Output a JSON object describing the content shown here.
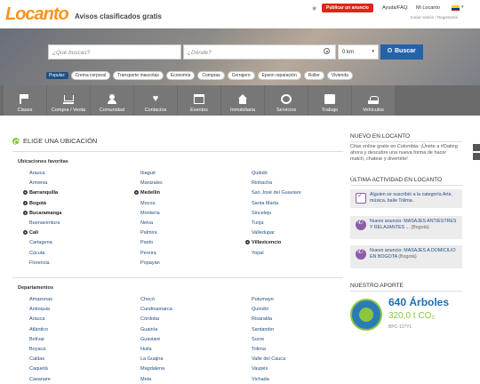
{
  "header": {
    "logo": "Locanto",
    "tagline": "Avisos clasificados gratis",
    "publish_label": "Publicar un anuncio",
    "help_label": "Ayuda/FAQ:",
    "my_label": "Mi Locanto",
    "login_links": "Iniciar sesión / Registrarse"
  },
  "search": {
    "what_placeholder": "¿Qué buscas?",
    "where_placeholder": "¿Dónde?",
    "radius_value": "0 km",
    "button_label": "Buscar",
    "popular_label": "Popular:",
    "popular_chips": [
      "Crema corporal",
      "Transporte mascotas",
      "Economía",
      "Compras",
      "Cerrajero",
      "Epson reparación",
      "Roller",
      "Vivienda"
    ]
  },
  "categories": [
    "Clases",
    "Compra / Venta",
    "Comunidad",
    "Contactos",
    "Eventos",
    "Inmobiliaria",
    "Servicios",
    "Trabajo",
    "Vehículos"
  ],
  "location": {
    "title": "ELIGE UNA UBICACIÓN",
    "favorites_title": "Ubicaciones favoritas",
    "favorites_col1": [
      {
        "name": "Arauca",
        "bold": false
      },
      {
        "name": "Armenia",
        "bold": false
      },
      {
        "name": "Barranquilla",
        "bold": true
      },
      {
        "name": "Bogotá",
        "bold": true
      },
      {
        "name": "Bucaramanga",
        "bold": true
      },
      {
        "name": "Buenaventura",
        "bold": false
      },
      {
        "name": "Cali",
        "bold": true
      },
      {
        "name": "Cartagena",
        "bold": false
      },
      {
        "name": "Cúcuta",
        "bold": false
      },
      {
        "name": "Florencia",
        "bold": false
      }
    ],
    "favorites_col2": [
      {
        "name": "Ibagué",
        "bold": false
      },
      {
        "name": "Manizales",
        "bold": false
      },
      {
        "name": "Medellín",
        "bold": true
      },
      {
        "name": "Mocoa",
        "bold": false
      },
      {
        "name": "Montería",
        "bold": false
      },
      {
        "name": "Neiva",
        "bold": false
      },
      {
        "name": "Palmira",
        "bold": false
      },
      {
        "name": "Pasto",
        "bold": false
      },
      {
        "name": "Pereira",
        "bold": false
      },
      {
        "name": "Popayán",
        "bold": false
      }
    ],
    "favorites_col3": [
      {
        "name": "Quibdó",
        "bold": false
      },
      {
        "name": "Riohacha",
        "bold": false
      },
      {
        "name": "San José del Guaviare",
        "bold": false
      },
      {
        "name": "Santa Marta",
        "bold": false
      },
      {
        "name": "Sincelejo",
        "bold": false
      },
      {
        "name": "Tunja",
        "bold": false
      },
      {
        "name": "Valledupar",
        "bold": false
      },
      {
        "name": "Villavicencio",
        "bold": true
      },
      {
        "name": "Yopal",
        "bold": false
      }
    ],
    "departments_title": "Departamentos",
    "departments_col1": [
      "Amazonas",
      "Antioquia",
      "Arauca",
      "Atlántico",
      "Bolívar",
      "Boyacá",
      "Caldas",
      "Caquetá",
      "Casanare"
    ],
    "departments_col2": [
      "Chocó",
      "Cundinamarca",
      "Córdoba",
      "Guainía",
      "Guaviare",
      "Huila",
      "La Guajira",
      "Magdalena",
      "Meta"
    ],
    "departments_col3": [
      "Putumayo",
      "Quindío",
      "Risaralda",
      "Santander",
      "Sucre",
      "Tolima",
      "Valle del Cauca",
      "Vaupés",
      "Vichada"
    ]
  },
  "sidebar": {
    "new_title": "NUEVO EN LOCANTO",
    "new_text": "Citas online gratis en Colombia: ¡Únete a #Dating ahora y descubre una nueva forma de hacer match, chatear y divertirte!",
    "activity_title": "ÚLTIMA ACTIVIDAD EN LOCANTO",
    "activity": [
      {
        "text": "Alguien se suscribió a la categoría Arte, música, baile Tolima.",
        "city": ""
      },
      {
        "text": "Nuevo anuncio: MASAJES ANTIESTRES Y RELAJANTES ...",
        "city": "(Bogotá)"
      },
      {
        "text": "Nuevo anuncio: MASAJES A DOMICILIO EN BOGOTA",
        "city": "(Bogotá)"
      }
    ],
    "contribution_title": "NUESTRO APORTE",
    "trees": "640 Árboles",
    "co2": "320,0 t CO₂",
    "bpc": "BPC-127YL"
  }
}
